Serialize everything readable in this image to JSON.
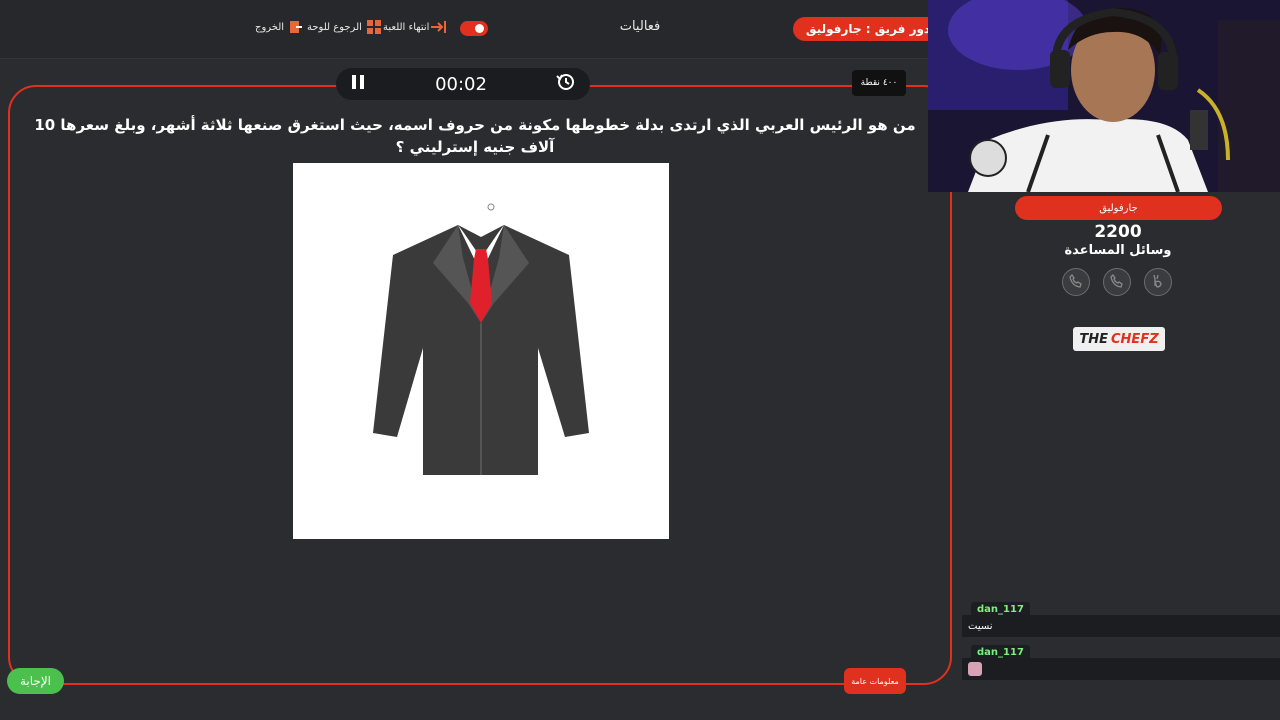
{
  "topbar": {
    "exit_label": "الخروج",
    "back_label": "الرجوع للوحة",
    "end_game_label": "انتهاء اللعبة",
    "title": "فعاليات",
    "turn_label": "دور فريق : جارفوليق"
  },
  "timer": {
    "value": "00:02"
  },
  "points_badge": "٤٠٠ نقطة",
  "question": "من هو الرئيس العربي الذي ارتدى بدلة خطوطها مكونة من حروف اسمه، حيث استغرق صنعها ثلاثة أشهر، وبلغ سعرها 10 آلاف جنيه إسترليني ؟",
  "question_image": {
    "icon": "suit-icon"
  },
  "team": {
    "name": "جارفوليق",
    "score": "2200",
    "aids_label": "وسائل المساعدة",
    "aids": [
      "call-transfer-icon",
      "phone-icon",
      "two-answers-icon"
    ]
  },
  "sponsor": {
    "the": "THE",
    "chefz": "CHEFZ"
  },
  "chat": [
    {
      "user": "dan_117",
      "message": "نسيت"
    },
    {
      "user": "dan_117",
      "message": ""
    }
  ],
  "buttons": {
    "answer": "الإجابة",
    "general_info": "معلومات عامة"
  },
  "colors": {
    "accent": "#e0301e",
    "answer": "#4cc04c",
    "background": "#2a2c2f"
  }
}
